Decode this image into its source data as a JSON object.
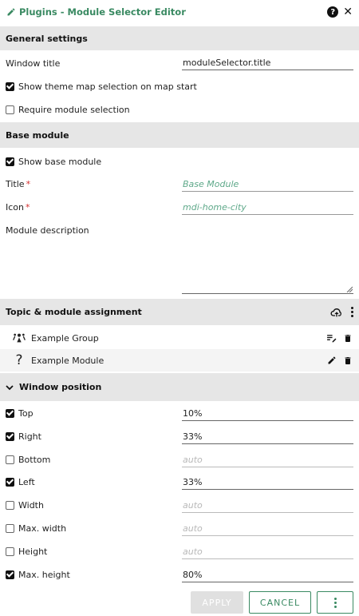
{
  "window": {
    "title": "Plugins - Module Selector Editor"
  },
  "general": {
    "header": "General settings",
    "window_title_label": "Window title",
    "window_title_value": "moduleSelector.title",
    "show_theme_map": {
      "label": "Show theme map selection on map start",
      "checked": true
    },
    "require_module": {
      "label": "Require module selection",
      "checked": false
    }
  },
  "base": {
    "header": "Base module",
    "show_base": {
      "label": "Show base module",
      "checked": true
    },
    "title_label": "Title",
    "title_placeholder": "Base Module",
    "icon_label": "Icon",
    "icon_placeholder": "mdi-home-city",
    "required_mark": "*",
    "description_label": "Module description"
  },
  "assignment": {
    "header": "Topic & module assignment",
    "items": [
      {
        "label": "Example Group",
        "icon": "group-icon"
      },
      {
        "label": "Example Module",
        "icon": "question-mark-icon"
      }
    ]
  },
  "position": {
    "header": "Window position",
    "rows": [
      {
        "label": "Top",
        "checked": true,
        "value": "10%"
      },
      {
        "label": "Right",
        "checked": true,
        "value": "33%"
      },
      {
        "label": "Bottom",
        "checked": false,
        "value": "auto"
      },
      {
        "label": "Left",
        "checked": true,
        "value": "33%"
      },
      {
        "label": "Width",
        "checked": false,
        "value": "auto"
      },
      {
        "label": "Max. width",
        "checked": false,
        "value": "auto"
      },
      {
        "label": "Height",
        "checked": false,
        "value": "auto"
      },
      {
        "label": "Max. height",
        "checked": true,
        "value": "80%"
      }
    ]
  },
  "buttons": {
    "apply": "APPLY",
    "cancel": "CANCEL"
  },
  "colors": {
    "accent": "#3a8a62",
    "section_bg": "#e6e6e6",
    "required": "#d32f2f"
  }
}
